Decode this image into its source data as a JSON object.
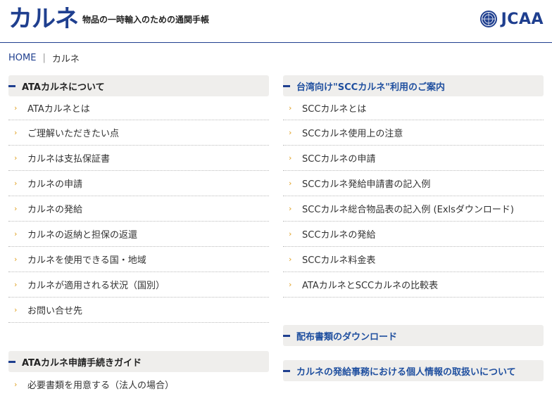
{
  "header": {
    "logo_text": "カルネ",
    "subtitle": "物品の一時輸入のための通関手帳",
    "org_logo_text": "JCAA",
    "org_emblem": "jcaa-emblem-icon"
  },
  "breadcrumb": {
    "home": "HOME",
    "separator": "|",
    "current": "カルネ"
  },
  "left": {
    "section1": {
      "title": "ATAカルネについて",
      "items": [
        "ATAカルネとは",
        "ご理解いただきたい点",
        "カルネは支払保証書",
        "カルネの申請",
        "カルネの発給",
        "カルネの返納と担保の返還",
        "カルネを使用できる国・地域",
        "カルネが適用される状況（国別）",
        "お問い合せ先"
      ]
    },
    "section2": {
      "title": "ATAカルネ申請手続きガイド",
      "items": [
        "必要書類を用意する（法人の場合）"
      ]
    }
  },
  "right": {
    "section1": {
      "title": "台湾向け\"SCCカルネ\"利用のご案内",
      "items": [
        "SCCカルネとは",
        "SCCカルネ使用上の注意",
        "SCCカルネの申請",
        "SCCカルネ発給申請書の記入例",
        "SCCカルネ総合物品表の記入例 (Exlsダウンロード)",
        "SCCカルネの発給",
        "SCCカルネ料金表",
        "ATAカルネとSCCカルネの比較表"
      ]
    },
    "section2": {
      "title": "配布書類のダウンロード"
    },
    "section3": {
      "title": "カルネの発給事務における個人情報の取扱いについて"
    }
  },
  "colors": {
    "brand": "#1f3f8f",
    "chevron": "#e0a020",
    "section_bg": "#efeeec"
  }
}
